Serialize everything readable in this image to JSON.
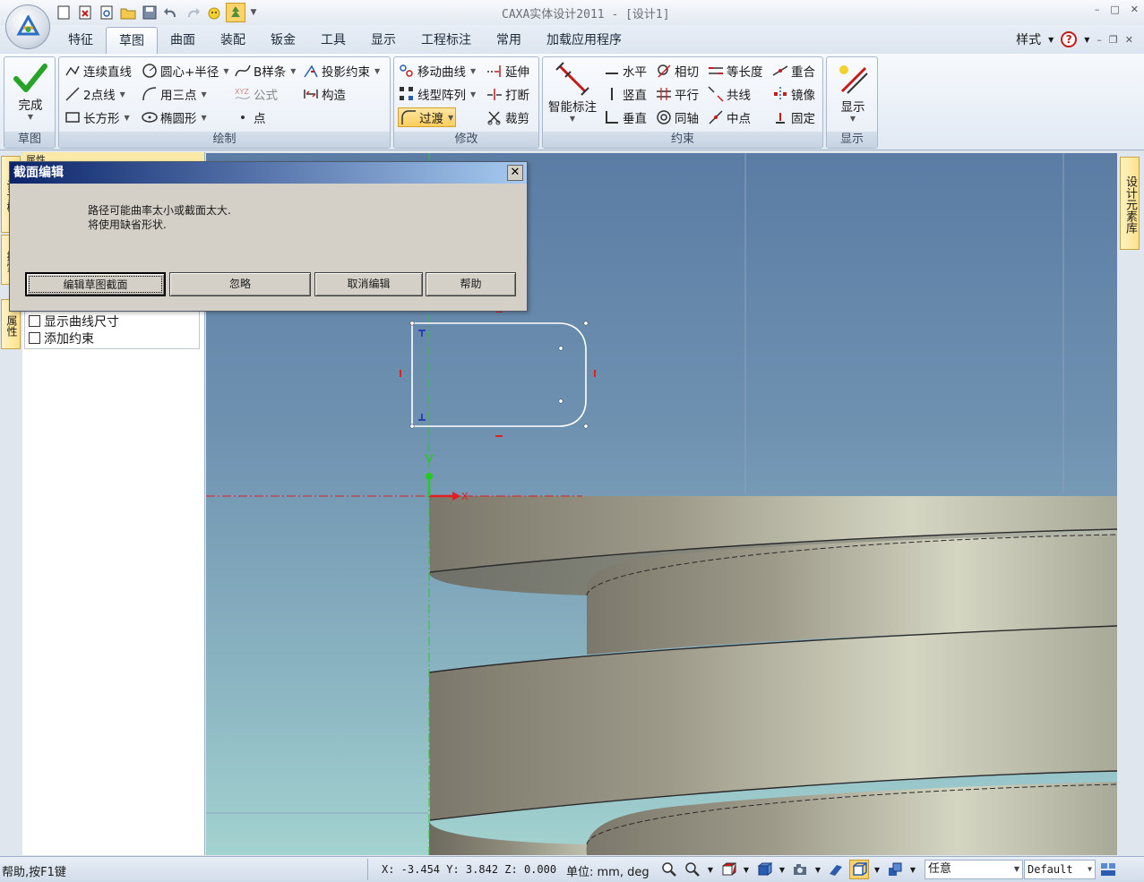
{
  "window": {
    "title": "CAXA实体设计2011 - [设计1]"
  },
  "menu_tabs": [
    "特征",
    "草图",
    "曲面",
    "装配",
    "钣金",
    "工具",
    "显示",
    "工程标注",
    "常用",
    "加载应用程序"
  ],
  "style_menu": {
    "label": "样式",
    "help_glyph": "?"
  },
  "ribbon": {
    "sketch_group": {
      "label": "草图",
      "finish_label": "完成"
    },
    "draw_group": {
      "label": "绘制",
      "polyline": "连续直线",
      "circle_radius": "圆心+半径",
      "bspline": "B样条",
      "project_constraint": "投影约束",
      "two_point_line": "2点线",
      "three_point": "用三点",
      "formula": "公式",
      "construct": "构造",
      "rectangle": "长方形",
      "ellipse": "椭圆形",
      "point": "点"
    },
    "modify_group": {
      "label": "修改",
      "move_curve": "移动曲线",
      "extend": "延伸",
      "linear_array": "线型阵列",
      "break": "打断",
      "fillet": "过渡",
      "trim": "裁剪"
    },
    "constraint_group": {
      "label": "约束",
      "smart_dimension": "智能标注",
      "horizontal": "水平",
      "tangent": "相切",
      "equal_length": "等长度",
      "coincident": "重合",
      "vertical": "竖直",
      "parallel": "平行",
      "collinear": "共线",
      "mirror": "镜像",
      "perpendicular": "垂直",
      "concentric": "同轴",
      "midpoint": "中点",
      "fix": "固定"
    },
    "display_group": {
      "label": "显示",
      "display_label": "显示"
    }
  },
  "left_panel": {
    "header": "属性",
    "side_tabs": [
      "设计树",
      "搜索",
      "属性"
    ],
    "options": [
      {
        "label": "显示曲线尺寸",
        "checked": false
      },
      {
        "label": "添加约束",
        "checked": false
      }
    ]
  },
  "right_panel": {
    "tab": "设计元素库"
  },
  "dialog": {
    "title": "截面编辑",
    "close_glyph": "✕",
    "message_line1": "路径可能曲率太小或截面太大.",
    "message_line2": "将使用缺省形状.",
    "buttons": {
      "edit_sketch": "编辑草图截面",
      "ignore": "忽略",
      "cancel_edit": "取消编辑",
      "help": "帮助"
    }
  },
  "viewport": {
    "axis_label": "X"
  },
  "statusbar": {
    "help": "帮助,按F1键",
    "coords": "X: -3.454 Y: 3.842 Z: 0.000",
    "unit": "单位: mm, deg",
    "filter_value": "任意",
    "style_value": "Default"
  },
  "colors": {
    "accent": "#c61b1b",
    "sketch_axis": "#e02020",
    "green_axis": "#22cc22",
    "highlight": "#ffcd5c"
  }
}
